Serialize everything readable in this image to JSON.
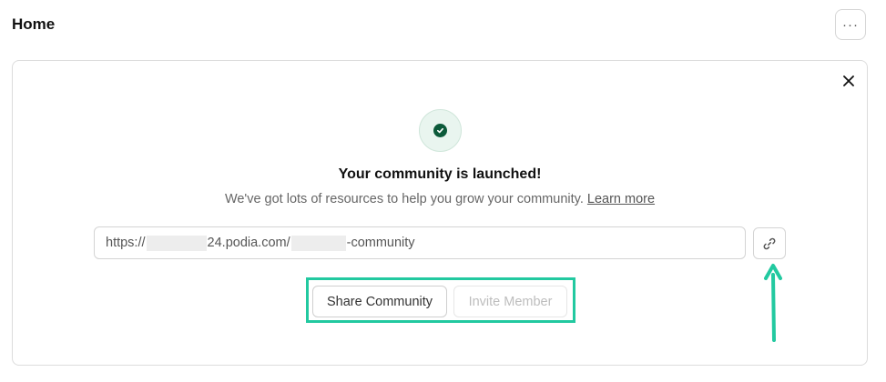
{
  "header": {
    "title": "Home",
    "more_label": "···"
  },
  "card": {
    "title": "Your community is launched!",
    "subtitle": "We've got lots of resources to help you grow your community.",
    "learn_more_label": "Learn more",
    "url": {
      "prefix": "https://",
      "domain_suffix": "24.podia.com/",
      "path_suffix": "-community"
    },
    "buttons": {
      "share_label": "Share Community",
      "invite_label": "Invite Member"
    }
  },
  "icons": {
    "more": "more-horizontal-icon",
    "close": "close-icon",
    "success": "check-circle-icon",
    "copy_link": "link-icon"
  },
  "colors": {
    "accent_highlight": "#22c9a0",
    "success_dark": "#0c5a3a",
    "success_light": "#e9f5ef"
  }
}
